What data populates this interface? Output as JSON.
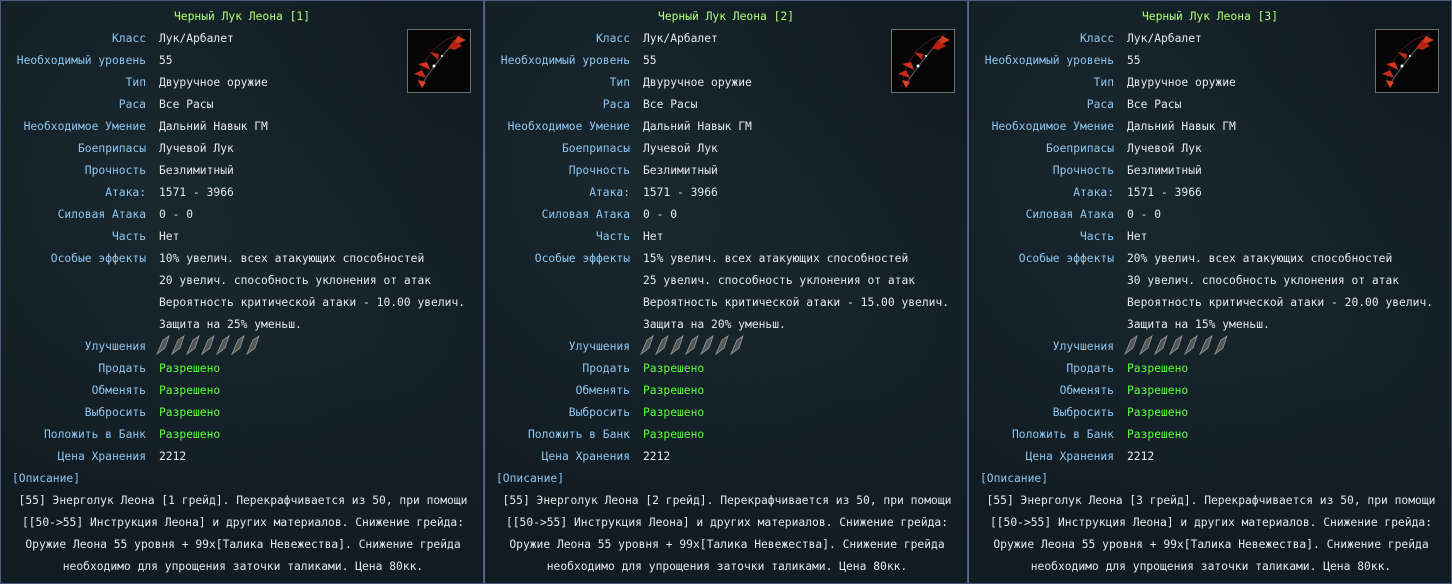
{
  "labels": {
    "class": "Класс",
    "level": "Необходимый уровень",
    "type": "Тип",
    "race": "Раса",
    "skill": "Необходимое Умение",
    "ammo": "Боеприпасы",
    "durability": "Прочность",
    "attack": "Атака:",
    "power_attack": "Силовая Атака",
    "part": "Часть",
    "effects": "Особые эффекты",
    "upgrades": "Улучшения",
    "sell": "Продать",
    "trade": "Обменять",
    "drop": "Выбросить",
    "bank": "Положить в Банк",
    "storage_price": "Цена Хранения",
    "description": "[Описание]"
  },
  "icons": {
    "item": "black-bow-icon",
    "upgrade": "upgrade-slot-icon"
  },
  "colors": {
    "title": "#b2ff7a",
    "label": "#8ec6f0",
    "value": "#e4e8ec",
    "allowed": "#5cff3c"
  },
  "panels": [
    {
      "title": "Черный Лук Леона [1]",
      "class": "Лук/Арбалет",
      "level": "55",
      "type": "Двуручное оружие",
      "race": "Все Расы",
      "skill": "Дальний Навык ГМ",
      "ammo": "Лучевой Лук",
      "durability": "Безлимитный",
      "attack": "1571 - 3966",
      "power_attack": "0 - 0",
      "part": "Нет",
      "effects": [
        "10% увелич. всех атакующих способностей",
        "20 увелич. способность уклонения от атак",
        "Вероятность критической атаки - 10.00 увелич.",
        "Защита на 25% уменьш."
      ],
      "sell": "Разрешено",
      "trade": "Разрешено",
      "drop": "Разрешено",
      "bank": "Разрешено",
      "storage_price": "2212",
      "description": [
        "[55] Энерголук Леона [1 грейд]. Перекрафчивается из 50, при помощи",
        "[[50->55] Инструкция Леона] и других материалов. Снижение грейда:",
        "Оружие Леона 55 уровня + 99х[Талика Невежества]. Снижение грейда",
        "необходимо для упрощения заточки таликами. Цена 80кк."
      ]
    },
    {
      "title": "Черный Лук Леона [2]",
      "class": "Лук/Арбалет",
      "level": "55",
      "type": "Двуручное оружие",
      "race": "Все Расы",
      "skill": "Дальний Навык ГМ",
      "ammo": "Лучевой Лук",
      "durability": "Безлимитный",
      "attack": "1571 - 3966",
      "power_attack": "0 - 0",
      "part": "Нет",
      "effects": [
        "15% увелич. всех атакующих способностей",
        "25 увелич. способность уклонения от атак",
        "Вероятность критической атаки - 15.00 увелич.",
        "Защита на 20% уменьш."
      ],
      "sell": "Разрешено",
      "trade": "Разрешено",
      "drop": "Разрешено",
      "bank": "Разрешено",
      "storage_price": "2212",
      "description": [
        "[55] Энерголук Леона [2 грейд]. Перекрафчивается из 50, при помощи",
        "[[50->55] Инструкция Леона] и других материалов. Снижение грейда:",
        "Оружие Леона 55 уровня + 99х[Талика Невежества]. Снижение грейда",
        "необходимо для упрощения заточки таликами. Цена 80кк."
      ]
    },
    {
      "title": "Черный Лук Леона [3]",
      "class": "Лук/Арбалет",
      "level": "55",
      "type": "Двуручное оружие",
      "race": "Все Расы",
      "skill": "Дальний Навык ГМ",
      "ammo": "Лучевой Лук",
      "durability": "Безлимитный",
      "attack": "1571 - 3966",
      "power_attack": "0 - 0",
      "part": "Нет",
      "effects": [
        "20% увелич. всех атакующих способностей",
        "30 увелич. способность уклонения от атак",
        "Вероятность критической атаки - 20.00 увелич.",
        "Защита на 15% уменьш."
      ],
      "sell": "Разрешено",
      "trade": "Разрешено",
      "drop": "Разрешено",
      "bank": "Разрешено",
      "storage_price": "2212",
      "description": [
        "[55] Энерголук Леона [3 грейд]. Перекрафчивается из 50, при помощи",
        "[[50->55] Инструкция Леона] и других материалов. Снижение грейда:",
        "Оружие Леона 55 уровня + 99х[Талика Невежества]. Снижение грейда",
        "необходимо для упрощения заточки таликами. Цена 80кк."
      ]
    }
  ]
}
